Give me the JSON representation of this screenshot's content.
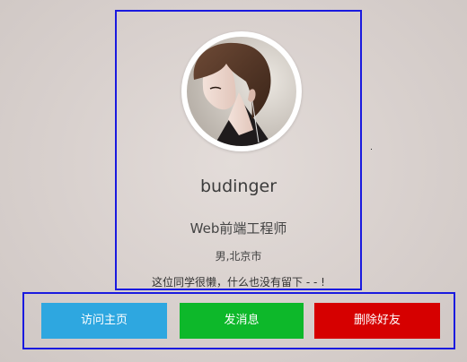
{
  "profile": {
    "username": "budinger",
    "job_title": "Web前端工程师",
    "location": "男,北京市",
    "bio": "这位同学很懒，什么也没有留下 - - !"
  },
  "actions": {
    "visit_label": "访问主页",
    "message_label": "发消息",
    "delete_label": "删除好友"
  },
  "colors": {
    "visit_button": "#2ea7e0",
    "message_button": "#0db82a",
    "delete_button": "#d60000",
    "outline": "#1a1adf"
  }
}
